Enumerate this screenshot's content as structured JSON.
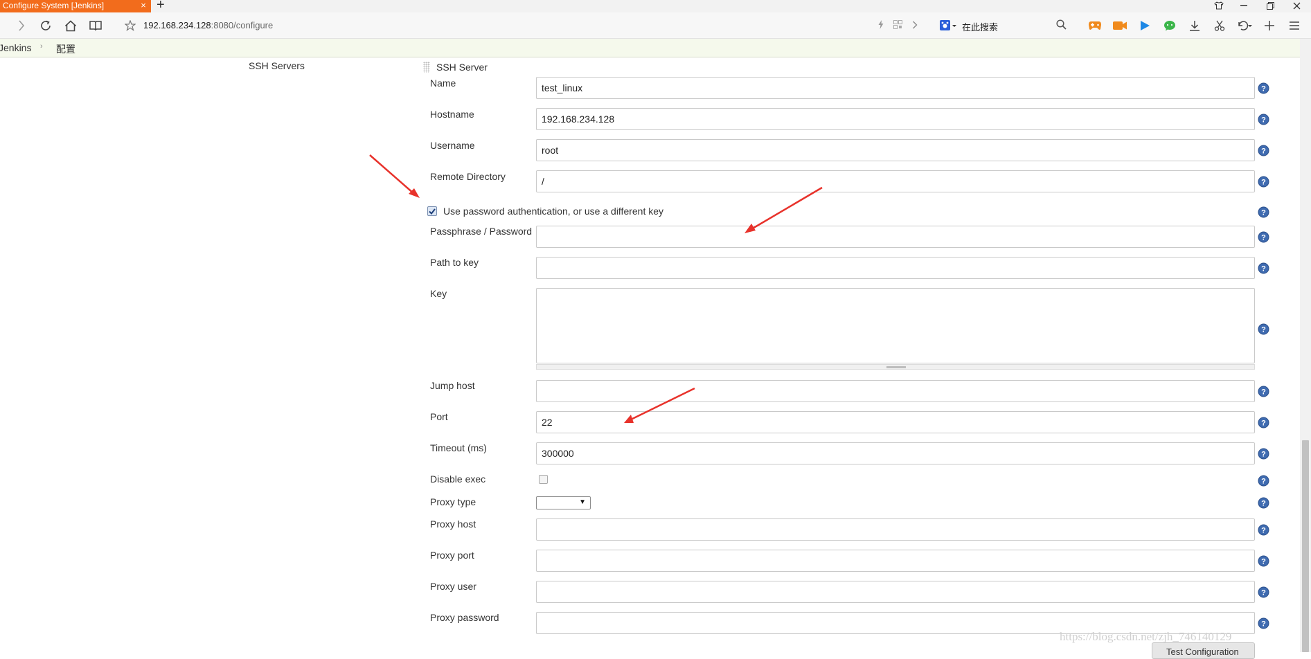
{
  "browser": {
    "tab_title": "Configure System [Jenkins]",
    "tab_close": "×",
    "new_tab": "+",
    "url_host": "192.168.234.128",
    "url_rest": ":8080/configure",
    "search_placeholder": "在此搜索"
  },
  "breadcrumb": {
    "root": "Jenkins",
    "separator": "›",
    "current": "配置"
  },
  "section": {
    "title": "SSH Servers",
    "subsection": "SSH Server"
  },
  "fields": {
    "name": {
      "label": "Name",
      "value": "test_linux"
    },
    "hostname": {
      "label": "Hostname",
      "value": "192.168.234.128"
    },
    "username": {
      "label": "Username",
      "value": "root"
    },
    "remote_directory": {
      "label": "Remote Directory",
      "value": "/"
    },
    "use_password": {
      "label": "Use password authentication, or use a different key",
      "checked": true
    },
    "passphrase": {
      "label": "Passphrase / Password",
      "value": ""
    },
    "path_to_key": {
      "label": "Path to key",
      "value": ""
    },
    "key": {
      "label": "Key",
      "value": ""
    },
    "jump_host": {
      "label": "Jump host",
      "value": ""
    },
    "port": {
      "label": "Port",
      "value": "22"
    },
    "timeout": {
      "label": "Timeout (ms)",
      "value": "300000"
    },
    "disable_exec": {
      "label": "Disable exec",
      "checked": false
    },
    "proxy_type": {
      "label": "Proxy type",
      "value": ""
    },
    "proxy_host": {
      "label": "Proxy host",
      "value": ""
    },
    "proxy_port": {
      "label": "Proxy port",
      "value": ""
    },
    "proxy_user": {
      "label": "Proxy user",
      "value": ""
    },
    "proxy_password": {
      "label": "Proxy password",
      "value": ""
    }
  },
  "buttons": {
    "test_configuration": "Test Configuration"
  },
  "watermark": "https://blog.csdn.net/zjh_746140129",
  "colors": {
    "tab_active": "#f26c1c",
    "breadcrumb_bg": "#f5f9ec",
    "help_icon": "#3f6bb0",
    "annotation_arrow": "#e8322b"
  }
}
